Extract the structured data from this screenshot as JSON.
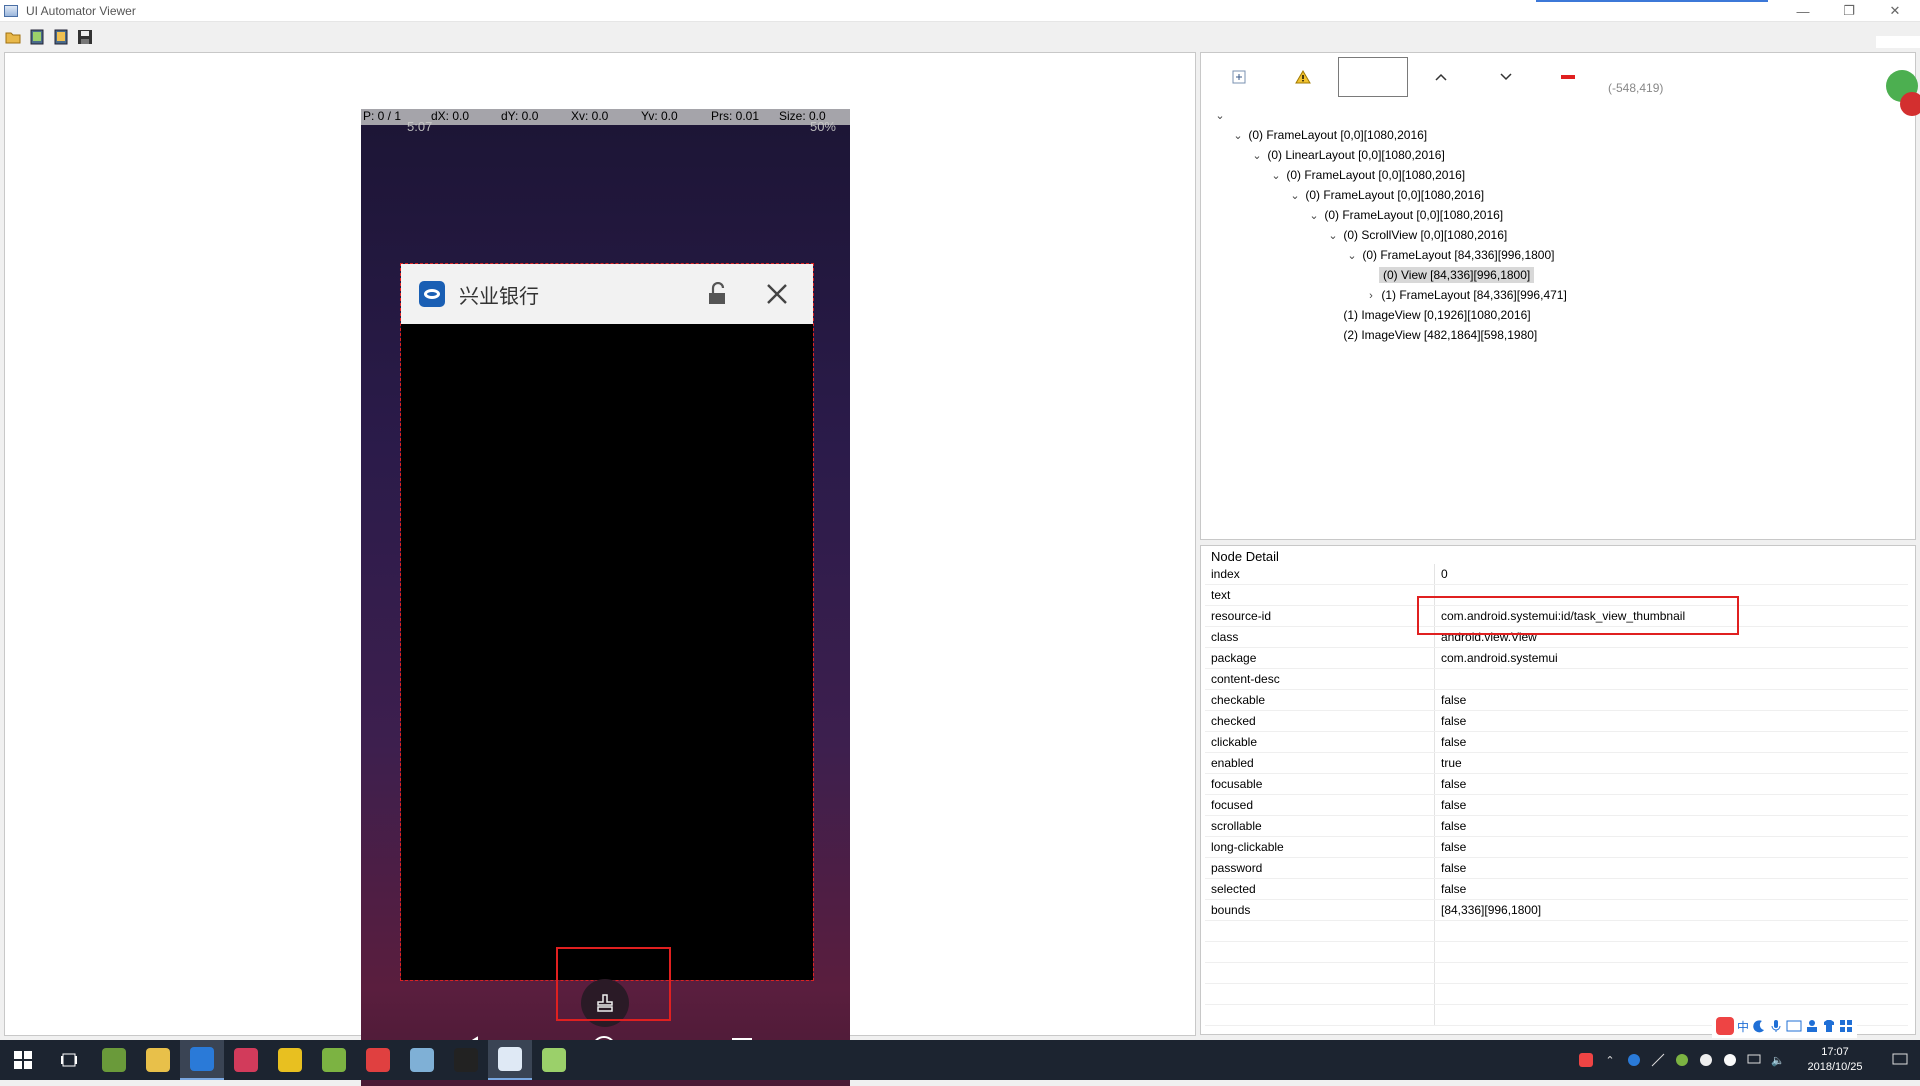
{
  "window": {
    "title": "UI Automator Viewer",
    "minimize_glyph": "—",
    "restore_glyph": "❐",
    "close_glyph": "✕"
  },
  "toolbar": {
    "icons": [
      "open-folder-icon",
      "device-screenshot-icon",
      "device-screenshot-compressed-icon",
      "save-icon"
    ]
  },
  "device": {
    "overlay": {
      "p": "P: 0 / 1",
      "dx": "dX: 0.0",
      "dy": "dY: 0.0",
      "xv": "Xv: 0.0",
      "yv": "Yv: 0.0",
      "prs": "Prs: 0.01",
      "size": "Size: 0.0"
    },
    "status_time": "5:07",
    "status_battery": "50%",
    "app_card": {
      "title": "兴业银行"
    }
  },
  "hierarchy": {
    "coords": "(-548,419)",
    "nodes": [
      {
        "label": "(0) FrameLayout [0,0][1080,2016]",
        "chevron": "down"
      },
      {
        "label": "(0) LinearLayout [0,0][1080,2016]",
        "chevron": "down"
      },
      {
        "label": "(0) FrameLayout [0,0][1080,2016]",
        "chevron": "down"
      },
      {
        "label": "(0) FrameLayout [0,0][1080,2016]",
        "chevron": "down"
      },
      {
        "label": "(0) FrameLayout [0,0][1080,2016]",
        "chevron": "down"
      },
      {
        "label": "(0) ScrollView [0,0][1080,2016]",
        "chevron": "down"
      },
      {
        "label": "(0) FrameLayout [84,336][996,1800]",
        "chevron": "down"
      },
      {
        "label": "(0) View [84,336][996,1800]",
        "chevron": "none",
        "selected": true
      },
      {
        "label": "(1) FrameLayout [84,336][996,471]",
        "chevron": "right"
      },
      {
        "label": "(1) ImageView [0,1926][1080,2016]",
        "chevron": "none"
      },
      {
        "label": "(2) ImageView [482,1864][598,1980]",
        "chevron": "none"
      }
    ]
  },
  "node_detail": {
    "title": "Node Detail",
    "rows": [
      {
        "key": "index",
        "value": "0"
      },
      {
        "key": "text",
        "value": ""
      },
      {
        "key": "resource-id",
        "value": "com.android.systemui:id/task_view_thumbnail"
      },
      {
        "key": "class",
        "value": "android.view.View"
      },
      {
        "key": "package",
        "value": "com.android.systemui"
      },
      {
        "key": "content-desc",
        "value": ""
      },
      {
        "key": "checkable",
        "value": "false"
      },
      {
        "key": "checked",
        "value": "false"
      },
      {
        "key": "clickable",
        "value": "false"
      },
      {
        "key": "enabled",
        "value": "true"
      },
      {
        "key": "focusable",
        "value": "false"
      },
      {
        "key": "focused",
        "value": "false"
      },
      {
        "key": "scrollable",
        "value": "false"
      },
      {
        "key": "long-clickable",
        "value": "false"
      },
      {
        "key": "password",
        "value": "false"
      },
      {
        "key": "selected",
        "value": "false"
      },
      {
        "key": "bounds",
        "value": "[84,336][996,1800]"
      },
      {
        "key": "",
        "value": ""
      },
      {
        "key": "",
        "value": ""
      },
      {
        "key": "",
        "value": ""
      },
      {
        "key": "",
        "value": ""
      },
      {
        "key": "",
        "value": ""
      }
    ]
  },
  "taskbar": {
    "apps": [
      {
        "name": "android-studio-icon",
        "color": "#6a9a3a"
      },
      {
        "name": "file-explorer-icon",
        "color": "#e8c04a"
      },
      {
        "name": "chrome-like-browser-icon",
        "color": "#2a7ad8",
        "active": true
      },
      {
        "name": "intellij-icon",
        "color": "#d23b5b"
      },
      {
        "name": "media-app-icon",
        "color": "#e8c020"
      },
      {
        "name": "android-device-icon",
        "color": "#7cb342"
      },
      {
        "name": "chrome-icon",
        "color": "#e04040"
      },
      {
        "name": "notes-icon",
        "color": "#7fb0d6"
      },
      {
        "name": "terminal-icon",
        "color": "#222222"
      },
      {
        "name": "uiautomator-window-icon",
        "color": "#dfe9f5",
        "active": true
      },
      {
        "name": "notepad-icon",
        "color": "#9bd06a"
      }
    ],
    "clock_time": "17:07",
    "clock_date": "2018/10/25"
  },
  "ime": {
    "lang": "中"
  }
}
